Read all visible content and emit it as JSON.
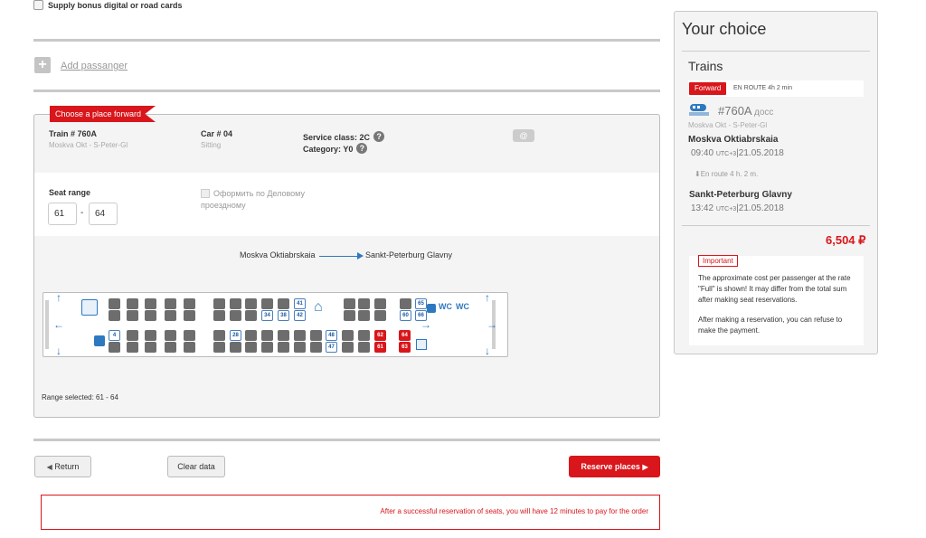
{
  "top": {
    "supply_label": "Supply bonus digital or road cards"
  },
  "add_passenger": "Add passanger",
  "car_panel": {
    "ribbon": "Choose a place forward",
    "train_label": "Train # 760A",
    "train_route": "Moskva Okt - S-Peter-Gl",
    "car_label": "Car # 04",
    "car_type": "Sitting",
    "service_class": "Service class: 2C",
    "category": "Category: Y0",
    "seat_range_label": "Seat range",
    "seat_from": "61",
    "seat_dash": "-",
    "seat_to": "64",
    "business_label_1": "Оформить по Деловому",
    "business_label_2": "проездному",
    "from_station": "Moskva Oktiabrskaia",
    "to_station": "Sankt-Peterburg Glavny",
    "wc1": "WC",
    "wc2": "WC",
    "free_seats_top": [
      "34",
      "38",
      "42",
      "41",
      "60",
      "65",
      "66"
    ],
    "free_seats_bottom": [
      "4",
      "28",
      "48",
      "47"
    ],
    "selected_seats": [
      "62",
      "61",
      "64",
      "63"
    ],
    "range_selected": "Range selected: 61 - 64"
  },
  "buttons": {
    "return": "Return",
    "clear": "Clear data",
    "reserve": "Reserve places"
  },
  "notice": "After a successful reservation of seats, you will have 12 minutes to pay for the order",
  "sidebar": {
    "title": "Your choice",
    "section": "Trains",
    "direction_badge": "Forward",
    "en_route": "EN ROUTE 4h 2 min",
    "train_no": "#760A",
    "train_suffix": "досс",
    "route": "Moskva Okt - S-Peter-Gl",
    "dep_station": "Moskva Oktiabrskaia",
    "dep_time": "09:40",
    "dep_tz": "UTC+3",
    "dep_date": "21.05.2018",
    "en_route_2": "En route  4 h. 2 m.",
    "arr_station": "Sankt-Peterburg Glavny",
    "arr_time": "13:42",
    "arr_tz": "UTC+3",
    "arr_date": "21.05.2018",
    "price": "6,504 ₽",
    "important_tag": "Important",
    "important_p1": "The approximate cost per passenger at the rate \"Full\" is shown! It may differ from the total sum after making seat reservations.",
    "important_p2": "After making a reservation, you can refuse to make the payment."
  },
  "colors": {
    "accent": "#d8161b",
    "link_blue": "#2e78c0"
  }
}
